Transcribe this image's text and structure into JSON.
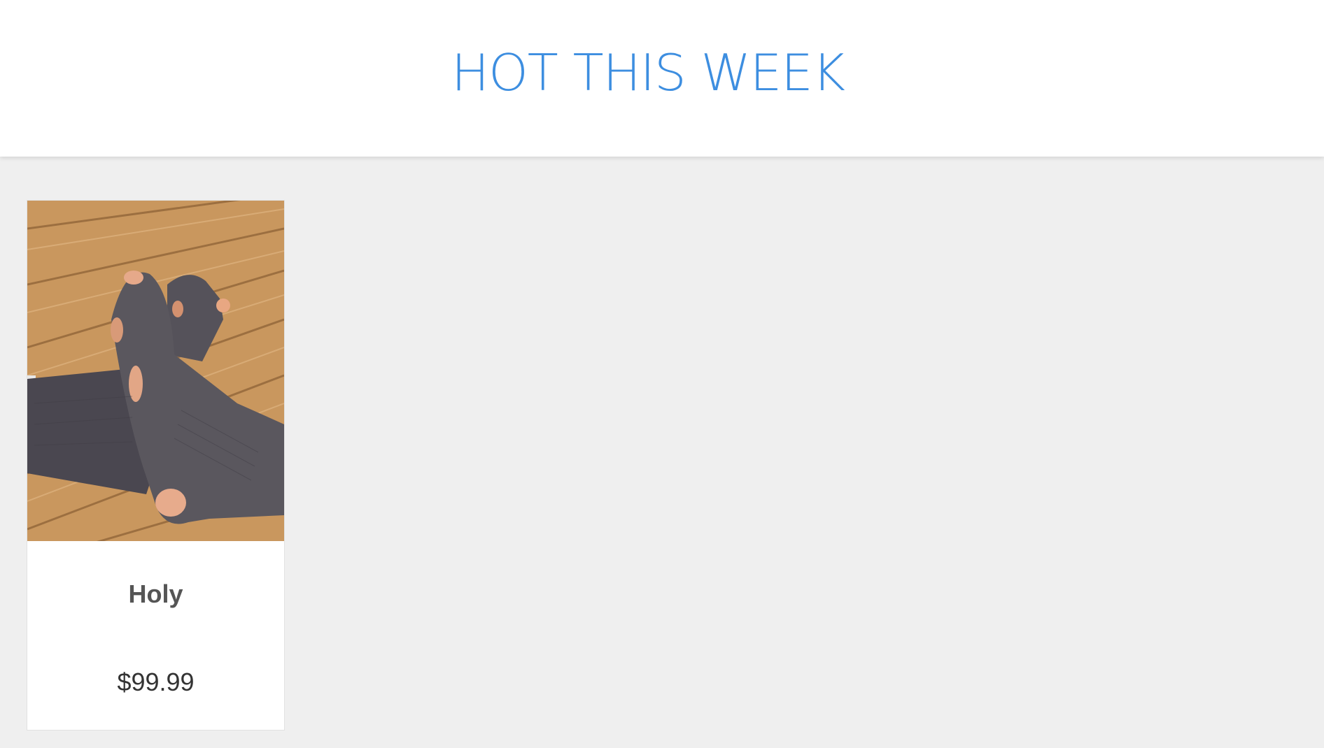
{
  "header": {
    "title": "HOT THIS WEEK",
    "title_color": "#3d8ee0"
  },
  "products": [
    {
      "name": "Holy",
      "price": "$99.99",
      "image_icon": "worn-socks-photo"
    }
  ],
  "colors": {
    "background": "#efefef",
    "card": "#ffffff"
  }
}
